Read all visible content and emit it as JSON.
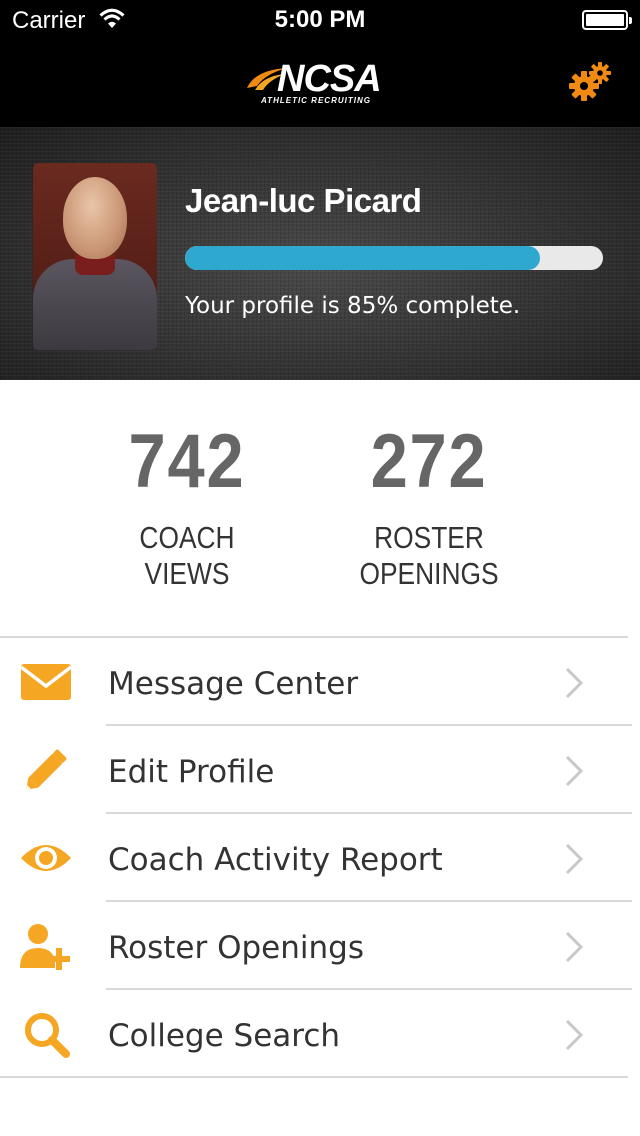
{
  "status_bar": {
    "carrier": "Carrier",
    "time": "5:00 PM"
  },
  "nav": {
    "brand": "NCSA",
    "tagline": "ATHLETIC RECRUITING"
  },
  "profile": {
    "name": "Jean-luc Picard",
    "completion_percent": 85,
    "completion_text": "Your profile is 85% complete."
  },
  "stats": [
    {
      "value": "742",
      "label_line1": "COACH",
      "label_line2": "VIEWS"
    },
    {
      "value": "272",
      "label_line1": "ROSTER",
      "label_line2": "OPENINGS"
    }
  ],
  "menu": [
    {
      "label": "Message Center",
      "icon": "envelope-icon"
    },
    {
      "label": "Edit Profile",
      "icon": "pencil-icon"
    },
    {
      "label": "Coach Activity Report",
      "icon": "eye-icon"
    },
    {
      "label": "Roster Openings",
      "icon": "add-user-icon"
    },
    {
      "label": "College Search",
      "icon": "search-icon"
    }
  ],
  "colors": {
    "accent_orange": "#f5a623",
    "progress_blue": "#2fa8cf",
    "progress_track": "#e9e9e9"
  }
}
